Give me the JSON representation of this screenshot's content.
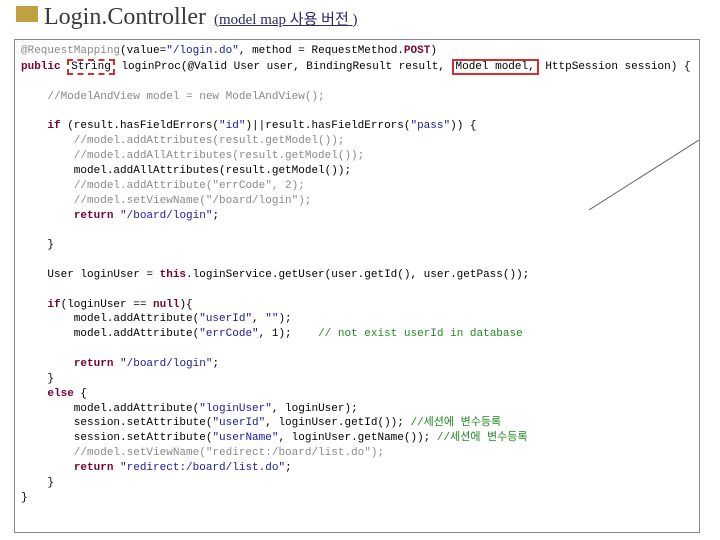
{
  "header": {
    "title": "Login.Controller",
    "subtitle": "(model  map 사용 버전 )"
  },
  "code": {
    "l01a": "@RequestMapping",
    "l01b": "(value=",
    "l01c": "\"/login.do\"",
    "l01d": ", method = RequestMethod.",
    "l01e": "POST",
    "l01f": ")",
    "l02a": "public",
    "l02b": "String",
    "l02c": "loginProc(@Valid User user, BindingResult result,",
    "l02d": "Model model,",
    "l02e": " HttpSession session) {",
    "l03": "    ",
    "l04": "    //ModelAndView model = new ModelAndView();",
    "l05": "    ",
    "l06a": "    ",
    "l06b": "if",
    "l06c": " (result.hasFieldErrors(",
    "l06d": "\"id\"",
    "l06e": ")||result.hasFieldErrors(",
    "l06f": "\"pass\"",
    "l06g": ")) {",
    "l07": "        //model.addAttributes(result.getModel());",
    "l08": "        //model.addAllAttributes(result.getModel());",
    "l09": "        model.addAllAttributes(result.getModel());",
    "l10a": "        ",
    "l10b": "//model.addAttribute(\"errCode\", 2);",
    "l11": "        //model.setViewName(\"/board/login\");",
    "l12a": "        ",
    "l12b": "return",
    "l12c": " ",
    "l12d": "\"/board/login\"",
    "l12e": ";",
    "l13": "    ",
    "l14": "    }",
    "l15": "    ",
    "l16a": "    User loginUser = ",
    "l16b": "this",
    "l16c": ".loginService.getUser(user.getId(), user.getPass());",
    "l17": "    ",
    "l18a": "    ",
    "l18b": "if",
    "l18c": "(loginUser == ",
    "l18d": "null",
    "l18e": "){",
    "l19a": "        model.addAttribute(",
    "l19b": "\"userId\"",
    "l19c": ", ",
    "l19d": "\"\"",
    "l19e": ");",
    "l20a": "        model.addAttribute(",
    "l20b": "\"errCode\"",
    "l20c": ", 1);    ",
    "l20d": "// not exist userId in database",
    "l21": "        ",
    "l22a": "        ",
    "l22b": "return",
    "l22c": " ",
    "l22d": "\"/board/login\"",
    "l22e": ";",
    "l23": "    }",
    "l24a": "    ",
    "l24b": "else",
    "l24c": " {",
    "l25a": "        model.addAttribute(",
    "l25b": "\"loginUser\"",
    "l25c": ", loginUser);",
    "l26a": "        session.setAttribute(",
    "l26b": "\"userId\"",
    "l26c": ", loginUser.getId()); ",
    "l26d": "//세션에 변수등록",
    "l27a": "        session.setAttribute(",
    "l27b": "\"userName\"",
    "l27c": ", loginUser.getName()); ",
    "l27d": "//세션에 변수등록",
    "l28": "        //model.setViewName(\"redirect:/board/list.do\");",
    "l29a": "        ",
    "l29b": "return",
    "l29c": " ",
    "l29d": "\"redirect:/board/list.do\"",
    "l29e": ";",
    "l30": "    }",
    "l31": "}"
  }
}
